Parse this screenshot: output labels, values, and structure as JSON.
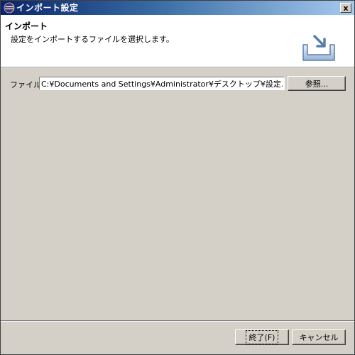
{
  "window": {
    "title": "インポート設定",
    "close_label": "x"
  },
  "header": {
    "title": "インポート",
    "description": "設定をインポートするファイルを選択します。",
    "icon": "import-tray-icon"
  },
  "form": {
    "file_label": "ファイル:",
    "file_value": "C:¥Documents and Settings¥Administrator¥デスクトップ¥設定.epf",
    "browse_label": "参照..."
  },
  "footer": {
    "finish_label": "終了(F)",
    "cancel_label": "キャンセル"
  },
  "colors": {
    "title_bar_start": "#0a246a",
    "title_bar_end": "#a6caf0",
    "dialog_background": "#d4d0c8",
    "header_background": "#ffffff"
  }
}
